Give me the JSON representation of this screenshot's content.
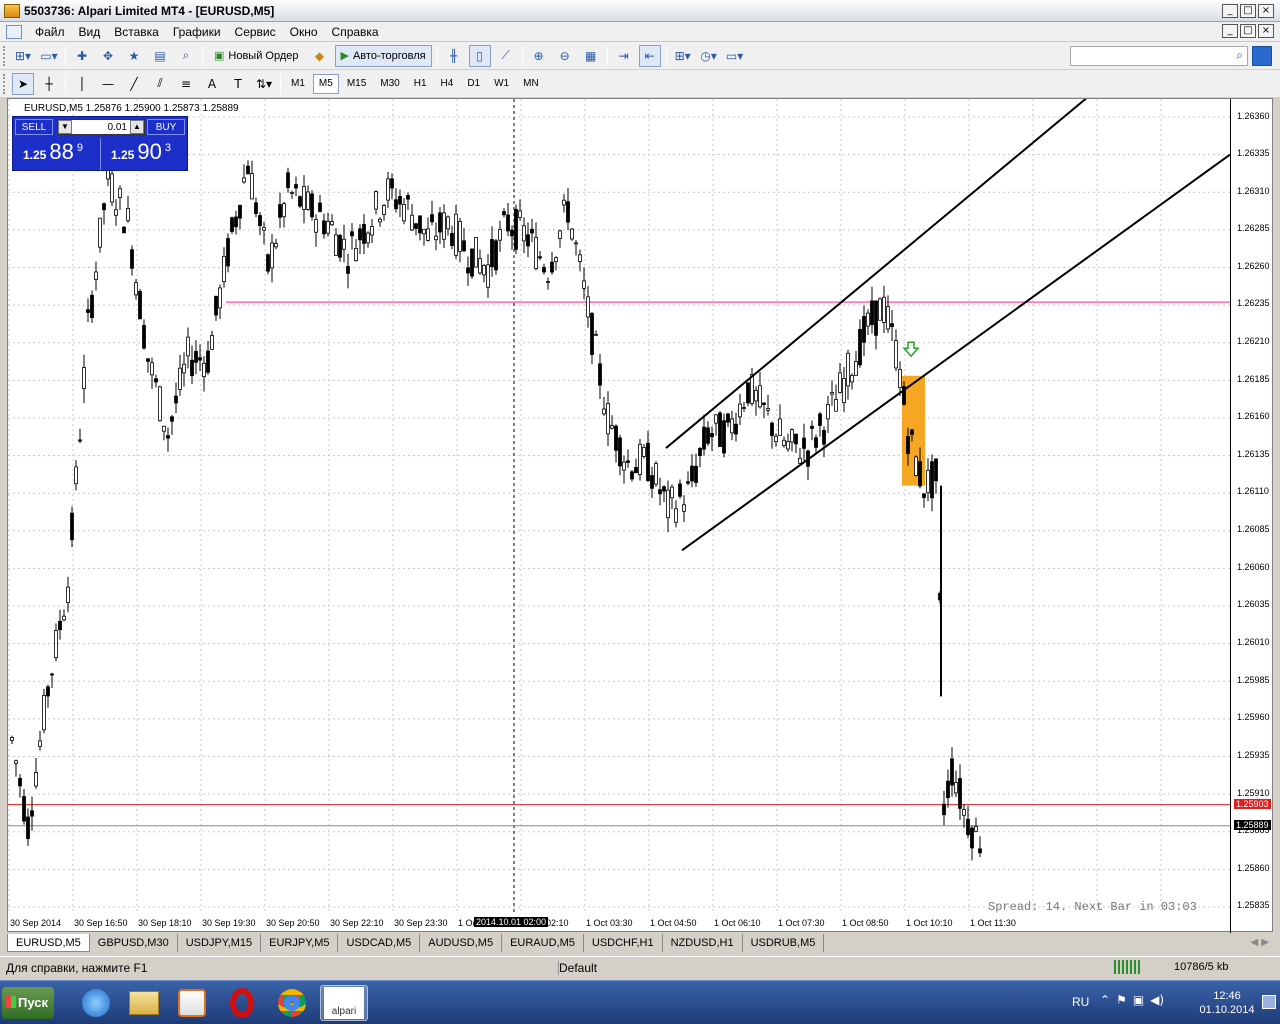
{
  "window": {
    "title": "5503736: Alpari Limited MT4 - [EURUSD,M5]",
    "controls": [
      "_",
      "□",
      "×"
    ]
  },
  "menu": [
    "Файл",
    "Вид",
    "Вставка",
    "Графики",
    "Сервис",
    "Окно",
    "Справка"
  ],
  "toolbar": {
    "new_order": "Новый Ордер",
    "auto_trading": "Авто-торговля",
    "search_placeholder": ""
  },
  "timeframes": [
    "M1",
    "M5",
    "M15",
    "M30",
    "H1",
    "H4",
    "D1",
    "W1",
    "MN"
  ],
  "selected_timeframe": "M5",
  "chart": {
    "header": "EURUSD,M5  1.25876 1.25900 1.25873 1.25889",
    "trade_panel": {
      "sell": "SELL",
      "buy": "BUY",
      "lot": "0.01",
      "bid_small": "1.25",
      "bid_big": "88",
      "bid_sup": "9",
      "ask_small": "1.25",
      "ask_big": "90",
      "ask_sup": "3"
    },
    "price_labels": [
      "1.26360",
      "1.26335",
      "1.26310",
      "1.26285",
      "1.26260",
      "1.26235",
      "1.26210",
      "1.26185",
      "1.26160",
      "1.26135",
      "1.26110",
      "1.26085",
      "1.26060",
      "1.26035",
      "1.26010",
      "1.25985",
      "1.25960",
      "1.25935",
      "1.25910",
      "1.25885",
      "1.25860",
      "1.25835"
    ],
    "ask_marker": "1.25903",
    "bid_marker": "1.25889",
    "time_labels": [
      "30 Sep 2014",
      "30 Sep 16:50",
      "30 Sep 18:10",
      "30 Sep 19:30",
      "30 Sep 20:50",
      "30 Sep 22:10",
      "30 Sep 23:30",
      "1 Oct 00:50",
      "1 Oct 02:10",
      "1 Oct 03:30",
      "1 Oct 04:50",
      "1 Oct 06:10",
      "1 Oct 07:30",
      "1 Oct 08:50",
      "1 Oct 10:10",
      "1 Oct 11:30"
    ],
    "crosshair_time": "2014.10.01 02:00",
    "spread_text": "Spread: 14. Next Bar in 03:03",
    "colors": {
      "horizontal_line": "#ff69b4",
      "ask_line": "#e02020",
      "highlight": "#f5a623",
      "arrow": "#2aa02a",
      "trade_panel": "#1c2fc8"
    }
  },
  "tabs": [
    "EURUSD,M5",
    "GBPUSD,M30",
    "USDJPY,M15",
    "EURJPY,M5",
    "USDCAD,M5",
    "AUDUSD,M5",
    "EURAUD,M5",
    "USDCHF,H1",
    "NZDUSD,H1",
    "USDRUB,M5"
  ],
  "status": {
    "help": "Для справки, нажмите F1",
    "profile": "Default",
    "traffic": "10786/5 kb"
  },
  "taskbar": {
    "start": "Пуск",
    "apps": [
      "internet-explorer-icon",
      "file-explorer-icon",
      "media-player-icon",
      "opera-icon",
      "chrome-icon",
      "alpari-icon"
    ],
    "alpari_label": "alpari",
    "language": "RU",
    "time": "12:46",
    "date": "01.10.2014"
  }
}
